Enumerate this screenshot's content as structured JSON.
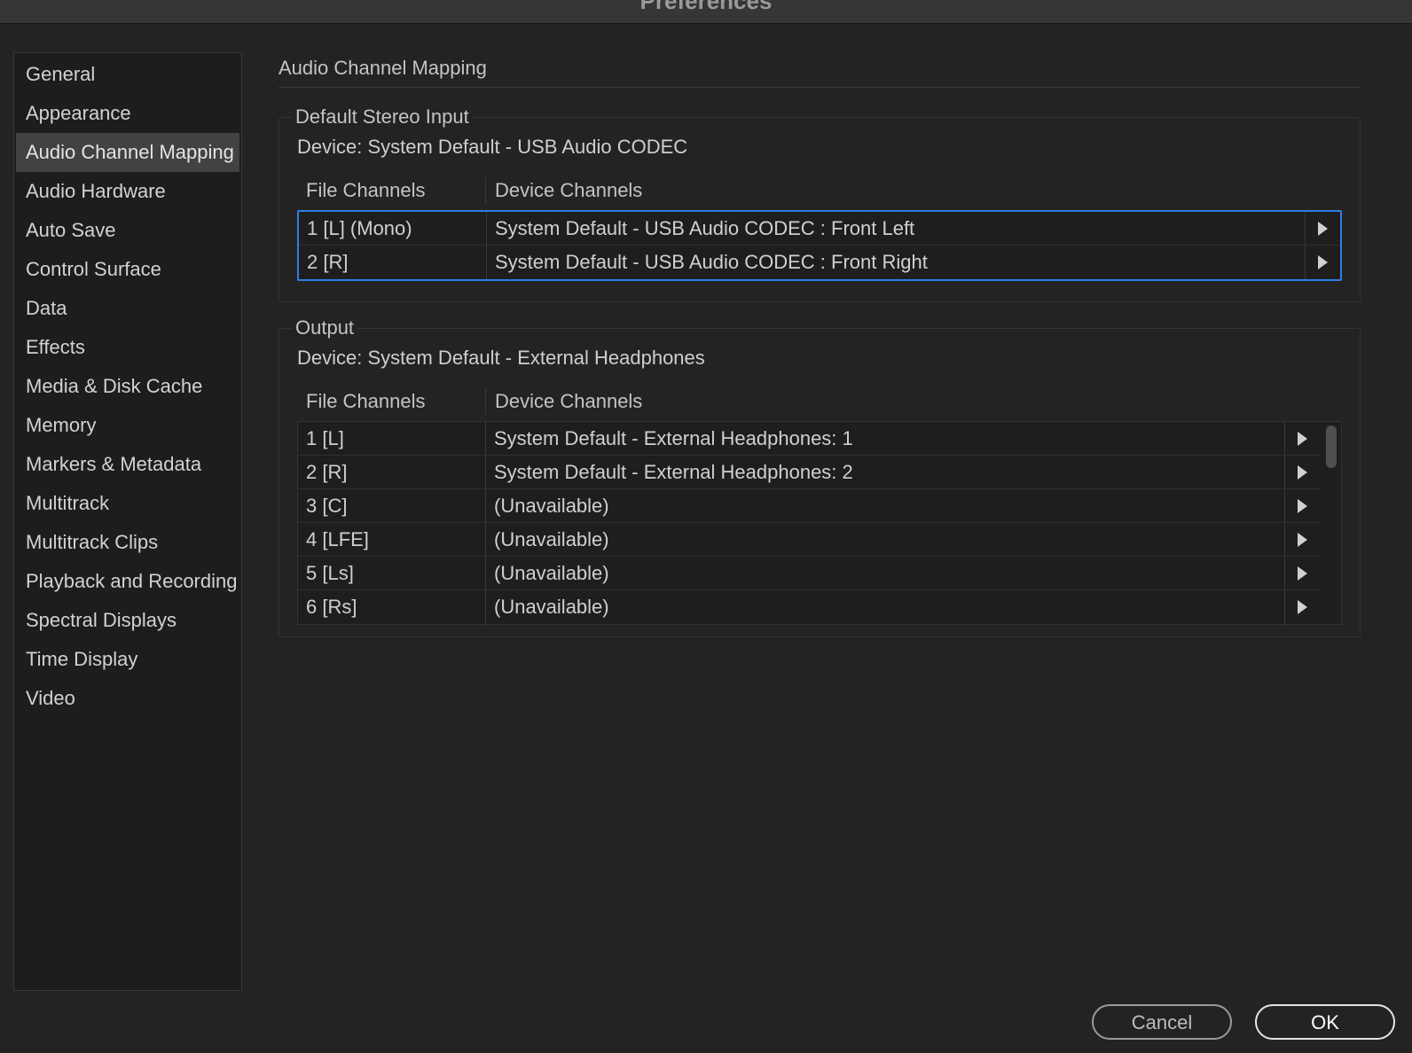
{
  "window": {
    "title": "Preferences"
  },
  "sidebar": {
    "items": [
      {
        "label": "General"
      },
      {
        "label": "Appearance"
      },
      {
        "label": "Audio Channel Mapping",
        "active": true
      },
      {
        "label": "Audio Hardware"
      },
      {
        "label": "Auto Save"
      },
      {
        "label": "Control Surface"
      },
      {
        "label": "Data"
      },
      {
        "label": "Effects"
      },
      {
        "label": "Media & Disk Cache"
      },
      {
        "label": "Memory"
      },
      {
        "label": "Markers & Metadata"
      },
      {
        "label": "Multitrack"
      },
      {
        "label": "Multitrack Clips"
      },
      {
        "label": "Playback and Recording"
      },
      {
        "label": "Spectral Displays"
      },
      {
        "label": "Time Display"
      },
      {
        "label": "Video"
      }
    ]
  },
  "main": {
    "title": "Audio Channel Mapping",
    "input": {
      "legend": "Default Stereo Input",
      "device": "Device: System Default - USB Audio CODEC",
      "col_file": "File Channels",
      "col_device": "Device Channels",
      "rows": [
        {
          "file": "1 [L] (Mono)",
          "device": "System Default - USB Audio CODEC : Front Left"
        },
        {
          "file": "2 [R]",
          "device": "System Default - USB Audio CODEC : Front Right"
        }
      ]
    },
    "output": {
      "legend": "Output",
      "device": "Device: System Default - External Headphones",
      "col_file": "File Channels",
      "col_device": "Device Channels",
      "rows": [
        {
          "file": "1 [L]",
          "device": "System Default - External Headphones: 1"
        },
        {
          "file": "2 [R]",
          "device": "System Default - External Headphones: 2"
        },
        {
          "file": "3 [C]",
          "device": "(Unavailable)"
        },
        {
          "file": "4 [LFE]",
          "device": "(Unavailable)"
        },
        {
          "file": "5 [Ls]",
          "device": "(Unavailable)"
        },
        {
          "file": "6 [Rs]",
          "device": "(Unavailable)"
        }
      ]
    }
  },
  "footer": {
    "cancel_label": "Cancel",
    "ok_label": "OK"
  },
  "colors": {
    "background": "#232323",
    "sidebar_bg": "#1d1d1d",
    "selected_item": "#424242",
    "focus_ring": "#2e7ee6"
  }
}
